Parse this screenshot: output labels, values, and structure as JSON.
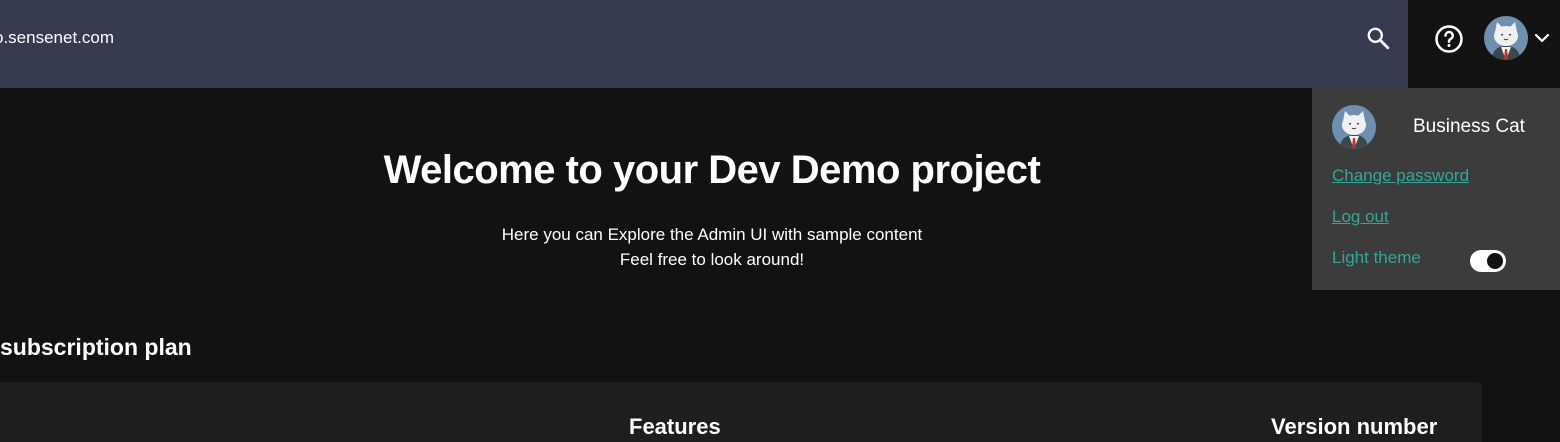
{
  "header": {
    "url_text": "o.sensenet.com"
  },
  "user_menu": {
    "name": "Business Cat",
    "change_password": "Change password",
    "log_out": "Log out",
    "theme_label": "Light theme",
    "theme_toggle_on": true
  },
  "welcome": {
    "title": "Welcome to your Dev Demo project",
    "line1": "Here you can Explore the Admin UI with sample content",
    "line2": "Feel free to look around!"
  },
  "subscription": {
    "section_title": "subscription plan",
    "columns": [
      "Features",
      "Version number"
    ]
  },
  "colors": {
    "header_bg": "#373b50",
    "page_bg": "#121212",
    "menu_bg": "#3c3c3c",
    "accent": "#2fa89a"
  },
  "icons": {
    "search": "search-icon",
    "help": "help-circle-icon",
    "chevron": "chevron-down-icon",
    "avatar": "cat-avatar"
  }
}
